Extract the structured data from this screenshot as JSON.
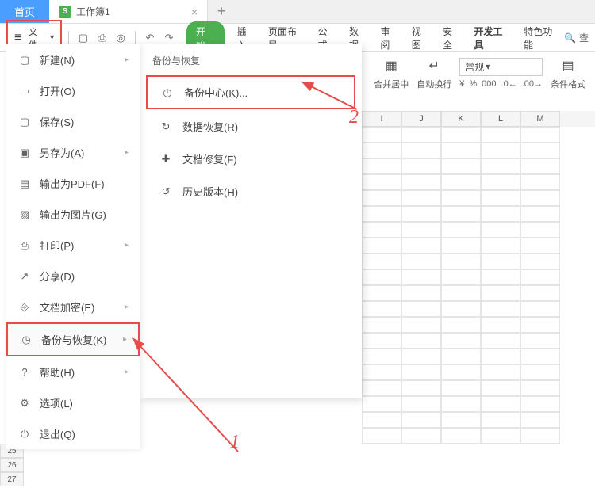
{
  "tabs": {
    "home": "首页",
    "doc": "工作簿1",
    "add": "+"
  },
  "file_button": "文件",
  "ribbon_tabs": [
    "开始",
    "插入",
    "页面布局",
    "公式",
    "数据",
    "审阅",
    "视图",
    "安全",
    "开发工具",
    "特色功能"
  ],
  "search": "查",
  "ribbon": {
    "merge_center": "合并居中",
    "wrap": "自动换行",
    "format_dropdown": "常规",
    "cond_format": "条件格式"
  },
  "file_menu": {
    "items": [
      {
        "label": "新建(N)",
        "arrow": true
      },
      {
        "label": "打开(O)",
        "arrow": false
      },
      {
        "label": "保存(S)",
        "arrow": false
      },
      {
        "label": "另存为(A)",
        "arrow": true
      },
      {
        "label": "输出为PDF(F)",
        "arrow": false
      },
      {
        "label": "输出为图片(G)",
        "arrow": false
      },
      {
        "label": "打印(P)",
        "arrow": true
      },
      {
        "label": "分享(D)",
        "arrow": false
      },
      {
        "label": "文档加密(E)",
        "arrow": true
      },
      {
        "label": "备份与恢复(K)",
        "arrow": true,
        "highlighted": true
      },
      {
        "label": "帮助(H)",
        "arrow": true
      },
      {
        "label": "选项(L)",
        "arrow": false
      },
      {
        "label": "退出(Q)",
        "arrow": false
      }
    ]
  },
  "submenu": {
    "title": "备份与恢复",
    "items": [
      {
        "label": "备份中心(K)...",
        "highlighted": true
      },
      {
        "label": "数据恢复(R)"
      },
      {
        "label": "文档修复(F)"
      },
      {
        "label": "历史版本(H)"
      }
    ]
  },
  "cols": [
    "I",
    "J",
    "K",
    "L",
    "M"
  ],
  "rows": [
    "25",
    "26",
    "27"
  ],
  "annotations": {
    "n1": "1",
    "n2": "2"
  }
}
